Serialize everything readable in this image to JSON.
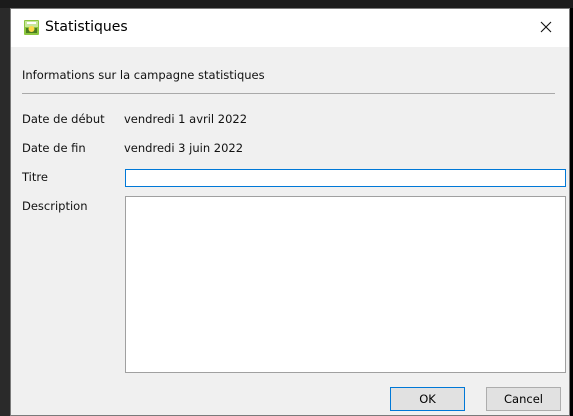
{
  "window": {
    "title": "Statistiques",
    "icon": "app-stats-icon",
    "close_icon": "close-icon"
  },
  "form": {
    "header": "Informations sur la campagne statistiques",
    "start_date_label": "Date de début",
    "start_date_value": "vendredi 1 avril 2022",
    "end_date_label": "Date de fin",
    "end_date_value": "vendredi 3 juin 2022",
    "title_label": "Titre",
    "title_value": "",
    "description_label": "Description",
    "description_value": ""
  },
  "buttons": {
    "ok": "OK",
    "cancel": "Cancel"
  },
  "colors": {
    "accent": "#0078d7",
    "dialog_bg": "#f0f0f0"
  }
}
